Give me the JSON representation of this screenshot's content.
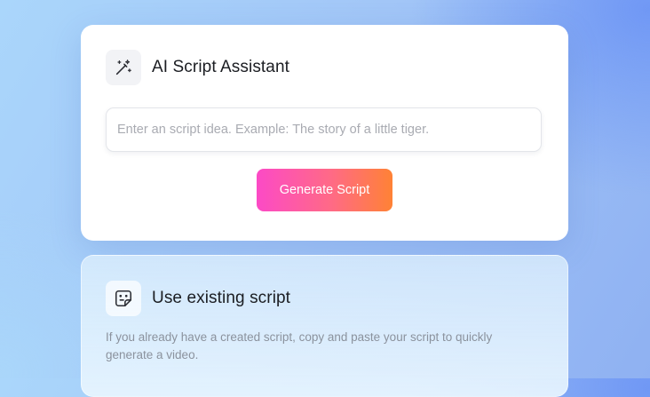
{
  "ai_card": {
    "icon": "magic-wand-icon",
    "title": "AI Script Assistant",
    "input_placeholder": "Enter an script idea. Example: The story of a little tiger.",
    "input_value": "",
    "button_label": "Generate Script"
  },
  "existing_card": {
    "icon": "document-icon",
    "title": "Use existing script",
    "description": "If you already have a created script, copy and paste your script to quickly generate a video."
  },
  "colors": {
    "button_gradient_start": "#fc4ac6",
    "button_gradient_end": "#ff8235",
    "title_text": "#1b1d22",
    "muted_text": "#8b929d"
  }
}
